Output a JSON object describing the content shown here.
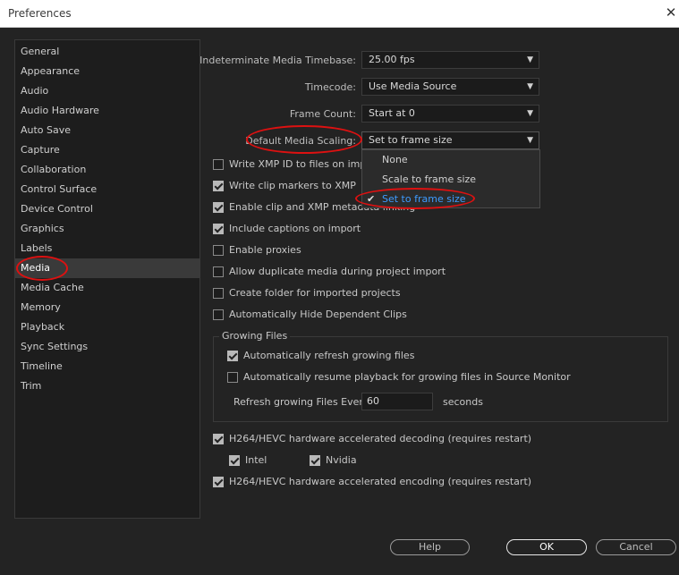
{
  "window": {
    "title": "Preferences"
  },
  "sidebar": {
    "items": [
      {
        "label": "General"
      },
      {
        "label": "Appearance"
      },
      {
        "label": "Audio"
      },
      {
        "label": "Audio Hardware"
      },
      {
        "label": "Auto Save"
      },
      {
        "label": "Capture"
      },
      {
        "label": "Collaboration"
      },
      {
        "label": "Control Surface"
      },
      {
        "label": "Device Control"
      },
      {
        "label": "Graphics"
      },
      {
        "label": "Labels"
      },
      {
        "label": "Media"
      },
      {
        "label": "Media Cache"
      },
      {
        "label": "Memory"
      },
      {
        "label": "Playback"
      },
      {
        "label": "Sync Settings"
      },
      {
        "label": "Timeline"
      },
      {
        "label": "Trim"
      }
    ],
    "selected": "Media"
  },
  "settings": {
    "timebase": {
      "label": "Indeterminate Media Timebase:",
      "value": "25.00 fps"
    },
    "timecode": {
      "label": "Timecode:",
      "value": "Use Media Source"
    },
    "frame_count": {
      "label": "Frame Count:",
      "value": "Start at 0"
    },
    "scaling": {
      "label": "Default Media Scaling:",
      "value": "Set to frame size"
    }
  },
  "scaling_menu": {
    "options": [
      {
        "label": "None",
        "selected": false
      },
      {
        "label": "Scale to frame size",
        "selected": false
      },
      {
        "label": "Set to frame size",
        "selected": true
      }
    ],
    "check_glyph": "✔"
  },
  "checkboxes": [
    {
      "label": "Write XMP ID to files on import",
      "checked": false
    },
    {
      "label": "Write clip markers to XMP",
      "checked": true
    },
    {
      "label": "Enable clip and XMP metadata linking",
      "checked": true
    },
    {
      "label": "Include captions on import",
      "checked": true
    },
    {
      "label": "Enable proxies",
      "checked": false
    },
    {
      "label": "Allow duplicate media during project import",
      "checked": false
    },
    {
      "label": "Create folder for imported projects",
      "checked": false
    },
    {
      "label": "Automatically Hide Dependent Clips",
      "checked": false
    }
  ],
  "growing_files": {
    "title": "Growing Files",
    "auto_refresh": {
      "label": "Automatically refresh growing files",
      "checked": true
    },
    "auto_resume": {
      "label": "Automatically resume playback for growing files in Source Monitor",
      "checked": false
    },
    "refresh_label": "Refresh growing Files Every",
    "refresh_value": "60",
    "refresh_unit": "seconds"
  },
  "hardware": {
    "decoding": {
      "label": "H264/HEVC hardware accelerated decoding (requires restart)",
      "checked": true
    },
    "intel": {
      "label": "Intel",
      "checked": true
    },
    "nvidia": {
      "label": "Nvidia",
      "checked": true
    },
    "encoding": {
      "label": "H264/HEVC hardware accelerated encoding (requires restart)",
      "checked": true
    }
  },
  "buttons": {
    "help": "Help",
    "ok": "OK",
    "cancel": "Cancel"
  },
  "icons": {
    "close": "close-icon",
    "chevron": "chevron-down-icon",
    "check": "check-icon"
  },
  "colors": {
    "accent": "#3d9bff",
    "annotation": "#dd1111"
  }
}
